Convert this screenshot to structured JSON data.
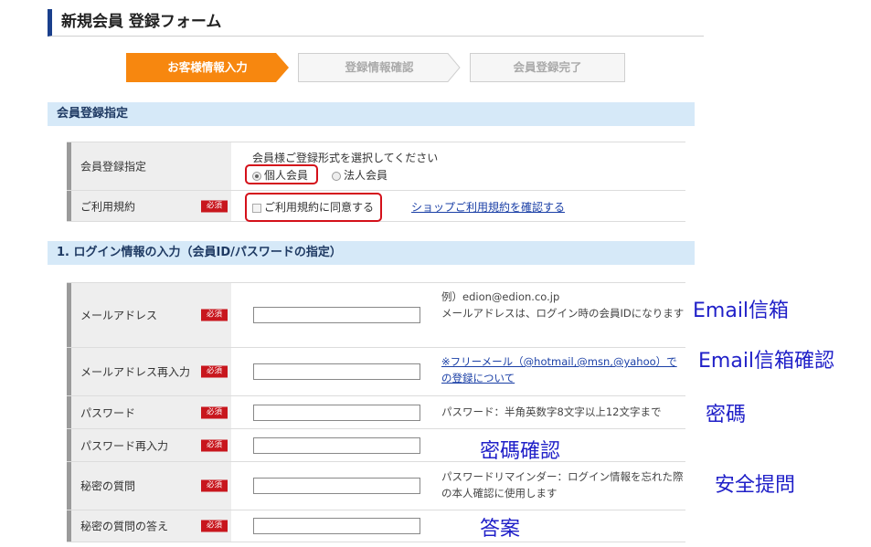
{
  "page": {
    "title": "新規会員 登録フォーム"
  },
  "steps": [
    {
      "label": "お客様情報入力",
      "active": true
    },
    {
      "label": "登録情報確認",
      "active": false
    },
    {
      "label": "会員登録完了",
      "active": false
    }
  ],
  "colors": {
    "active_step": "#f7870f",
    "section_bg": "#d6e9f8",
    "required": "#c8161d",
    "annotation": "#2020c8",
    "highlight": "#d4101a"
  },
  "section_membership": {
    "title": "会員登録指定",
    "type_row": {
      "label": "会員登録指定",
      "prompt": "会員様ご登録形式を選択してください",
      "option_personal": "個人会員",
      "option_corporate": "法人会員"
    },
    "terms_row": {
      "label": "ご利用規約",
      "required": "必須",
      "agree_label": "ご利用規約に同意する",
      "terms_link": "ショップご利用規約を確認する"
    }
  },
  "section_login": {
    "title": "1. ログイン情報の入力（会員ID/パスワードの指定）",
    "email": {
      "label": "メールアドレス",
      "required": "必須",
      "example": "例）edion@edion.co.jp",
      "help": "メールアドレスは、ログイン時の会員IDになります"
    },
    "email_confirm": {
      "label": "メールアドレス再入力",
      "required": "必須",
      "link": "※フリーメール（@hotmail,@msn,@yahoo）での登録について"
    },
    "password": {
      "label": "パスワード",
      "required": "必須",
      "help": "パスワード：半角英数字8文字以上12文字まで"
    },
    "password_confirm": {
      "label": "パスワード再入力",
      "required": "必須"
    },
    "secret_question": {
      "label": "秘密の質問",
      "required": "必須",
      "help": "パスワードリマインダー：ログイン情報を忘れた際の本人確認に使用します"
    },
    "secret_answer": {
      "label": "秘密の質問の答え",
      "required": "必須"
    }
  },
  "annotations": {
    "email": "Email信箱",
    "email_confirm": "Email信箱確認",
    "password": "密碼",
    "password_confirm": "密碼確認",
    "secret_question": "安全提問",
    "secret_answer": "答案"
  }
}
